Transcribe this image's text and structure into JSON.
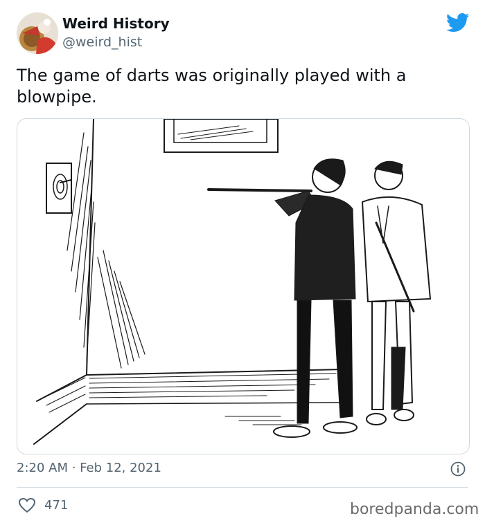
{
  "tweet": {
    "author_name": "Weird History",
    "author_handle": "@weird_hist",
    "text": "The game of darts was originally played with a blowpipe.",
    "timestamp": "2:20 AM · Feb 12, 2021",
    "likes": "471"
  },
  "watermark": "boredpanda.com",
  "icons": {
    "brand": "twitter-bird-icon",
    "info": "info-icon",
    "like": "heart-icon"
  },
  "colors": {
    "twitter_blue": "#1d9bf0",
    "secondary_text": "#536471",
    "border": "#cfd9de"
  }
}
